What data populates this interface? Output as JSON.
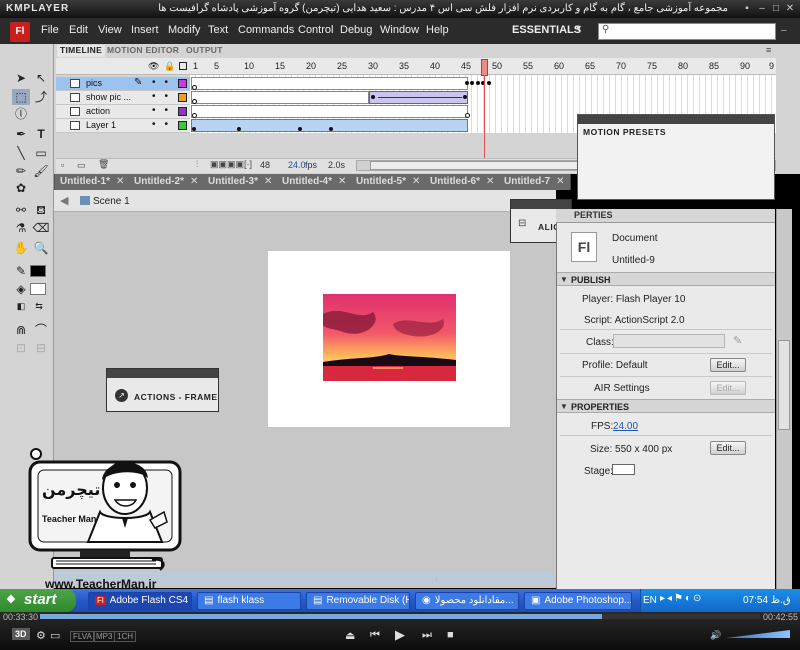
{
  "kmplayer": {
    "logo": "KMPLAYER",
    "caption": "مجموعه آموزشی جامع ، گام به گام و کاربردی نرم افزار فلش سی اس ۴ مدرس : سعید هدایی (تیچرمن) گروه آموزشی پادشاه گرافیست ها",
    "time_elapsed": "00:33:30",
    "time_total": "00:42:55",
    "progress": 0.78,
    "badges": [
      "FLVA",
      "MP3",
      "1CH"
    ]
  },
  "menu": {
    "app_logo": "Fl",
    "items": [
      "File",
      "Edit",
      "View",
      "Insert",
      "Modify",
      "Text",
      "Commands",
      "Control",
      "Debug",
      "Window",
      "Help"
    ],
    "workspace": "ESSENTIALS",
    "search_placeholder": ""
  },
  "timeline": {
    "tabs": [
      "TIMELINE",
      "MOTION EDITOR",
      "OUTPUT"
    ],
    "frame_numbers": [
      "1",
      "5",
      "10",
      "15",
      "20",
      "25",
      "30",
      "35",
      "40",
      "45",
      "50",
      "55",
      "60",
      "65",
      "70",
      "75",
      "80",
      "85",
      "90",
      "9"
    ],
    "layers": [
      {
        "name": "pics",
        "color": "#c83cdc",
        "selected": true
      },
      {
        "name": "show pic ...",
        "color": "#f0a020",
        "selected": false
      },
      {
        "name": "action",
        "color": "#8a36c8",
        "selected": false
      },
      {
        "name": "Layer 1",
        "color": "#3cc83c",
        "selected": false
      }
    ],
    "current_frame": "48",
    "fps": "24.0",
    "fps_unit": "fps",
    "time": "2.0s"
  },
  "doc_tabs": [
    "Untitled-1*",
    "Untitled-2*",
    "Untitled-3*",
    "Untitled-4*",
    "Untitled-5*",
    "Untitled-6*",
    "Untitled-7"
  ],
  "scene": "Scene 1",
  "panels": {
    "motion_presets": "MOTION PRESETS",
    "align": "ALIGN",
    "actions_frame": "ACTIONS - FRAME",
    "properties_tab": "PERTIES"
  },
  "properties": {
    "doc_icon": "Fl",
    "doc_type": "Document",
    "doc_name": "Untitled-9",
    "publish_title": "PUBLISH",
    "player": "Player: Flash Player 10",
    "script": "Script: ActionScript 2.0",
    "class_label": "Class:",
    "profile": "Profile: Default",
    "edit_label": "Edit...",
    "air_settings": "AIR  Settings",
    "properties_title": "PROPERTIES",
    "fps_label": "FPS:",
    "fps_value": "24.00",
    "size": "Size: 550 x 400 px",
    "stage_label": "Stage:"
  },
  "watermark": {
    "url": "www.TeacherMan.ir",
    "logo_text": "تیچرمن",
    "name": "Teacher Man"
  },
  "taskbar": {
    "start": "start",
    "tasks": [
      "Adobe Flash CS4 ...",
      "flash klass",
      "Removable Disk (H:)",
      "مقادانلود محصولا...",
      "Adobe Photoshop..."
    ],
    "lang": "EN",
    "clock": "07:54 ق.ظ"
  },
  "colors": {
    "accent": "#c8201f",
    "selection": "#9cc2ef",
    "span": "#b8d4f1",
    "tween": "#c9c5ef",
    "taskbar": "#2558c9",
    "start": "#2e8a2a"
  }
}
